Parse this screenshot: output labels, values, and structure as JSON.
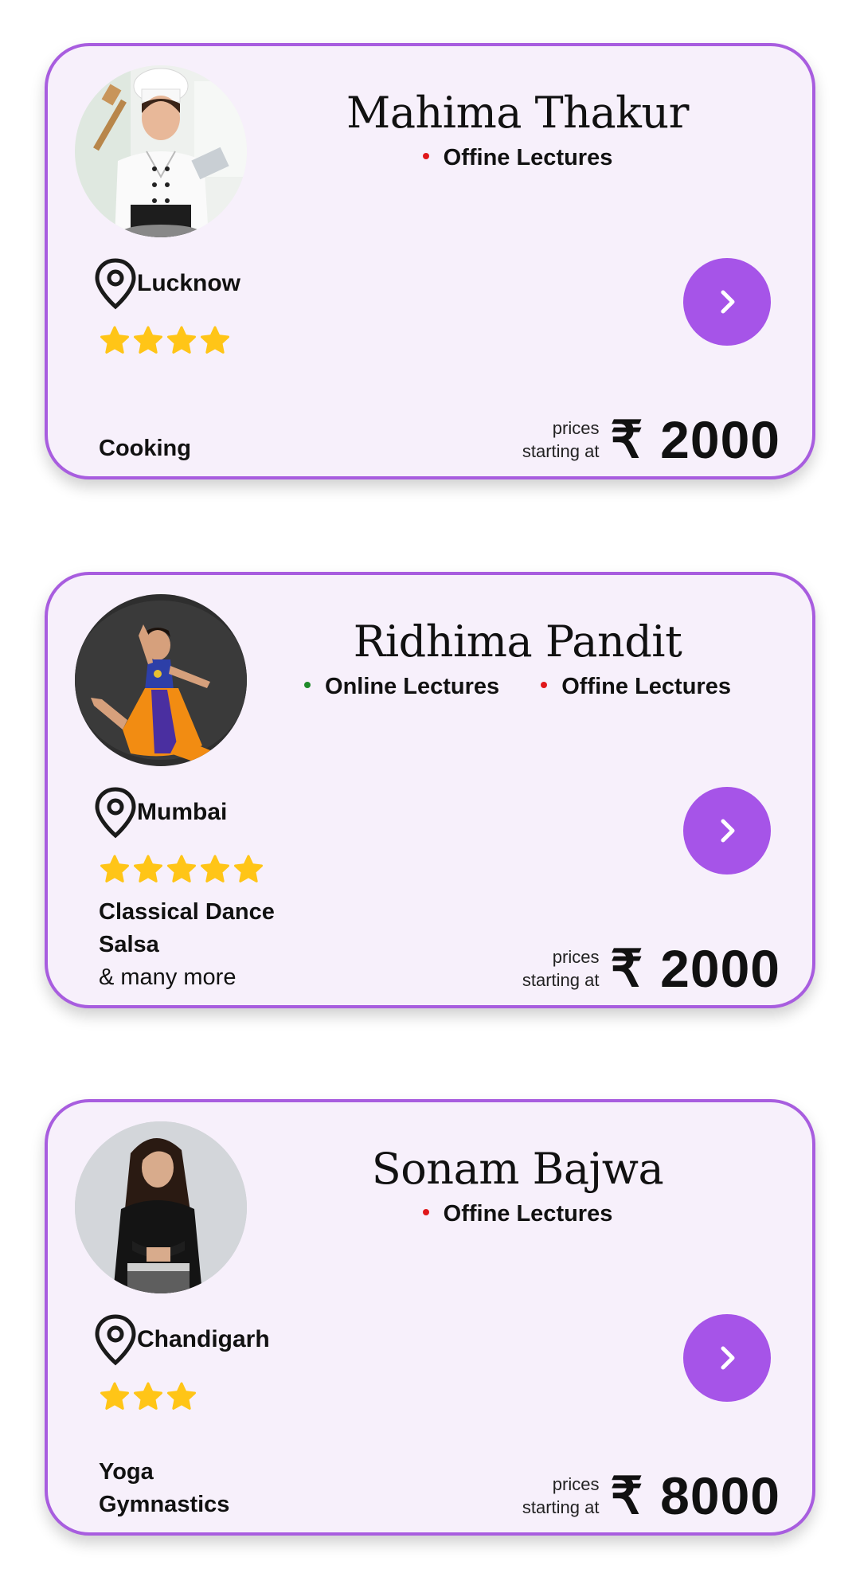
{
  "cards": [
    {
      "name": "Mahima Thakur",
      "lectures": [
        {
          "label": "Offine Lectures",
          "status_color": "#e0181b"
        }
      ],
      "location": "Lucknow",
      "rating": 4,
      "subjects": [
        "Cooking"
      ],
      "more": "",
      "price_label_1": "prices",
      "price_label_2": "starting at",
      "currency": "₹",
      "price": "2000",
      "photo": "chef-photo"
    },
    {
      "name": "Ridhima Pandit",
      "lectures": [
        {
          "label": "Online Lectures",
          "status_color": "#1f8a2a"
        },
        {
          "label": "Offine Lectures",
          "status_color": "#e0181b"
        }
      ],
      "location": "Mumbai",
      "rating": 5,
      "subjects": [
        "Classical Dance",
        "Salsa"
      ],
      "more": "& many more",
      "price_label_1": "prices",
      "price_label_2": "starting at",
      "currency": "₹",
      "price": "2000",
      "photo": "dancer-photo"
    },
    {
      "name": "Sonam Bajwa",
      "lectures": [
        {
          "label": "Offine Lectures",
          "status_color": "#e0181b"
        }
      ],
      "location": "Chandigarh",
      "rating": 3,
      "subjects": [
        "Yoga",
        "Gymnastics"
      ],
      "more": "",
      "price_label_1": "prices",
      "price_label_2": "starting at",
      "currency": "₹",
      "price": "8000",
      "photo": "instructor-photo"
    }
  ],
  "colors": {
    "accent": "#a654e8",
    "card_border": "#a85ddf",
    "card_bg": "#f7f0fb",
    "star": "#ffc517",
    "online_dot": "#1f8a2a",
    "offline_dot": "#e0181b"
  },
  "icons": {
    "location": "map-pin-icon",
    "rating": "star-icon",
    "next": "chevron-right-icon"
  }
}
